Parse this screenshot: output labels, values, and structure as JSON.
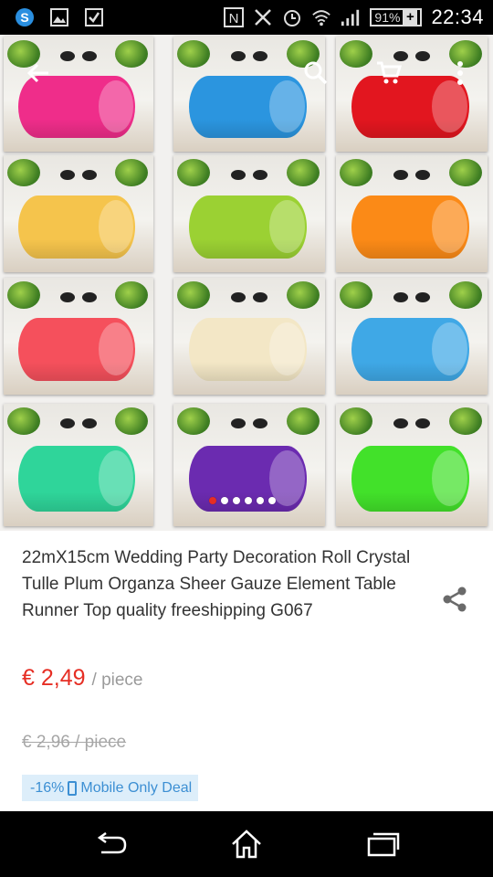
{
  "status_bar": {
    "time": "22:34",
    "battery_percent": "91%",
    "battery_plus": "+",
    "icons": [
      "skype-icon",
      "image-icon",
      "checkbox-icon",
      "nfc-icon",
      "vibrate-off-icon",
      "alarm-icon",
      "wifi-icon",
      "signal-icon"
    ]
  },
  "toolbar": {
    "icons": [
      "back-arrow-icon",
      "search-icon",
      "cart-icon",
      "more-vert-icon"
    ]
  },
  "gallery": {
    "image_count": 6,
    "active_index": 0,
    "swatches": [
      {
        "name": "fuchsia",
        "color": "#ef2d8a"
      },
      {
        "name": "blue",
        "color": "#2b95df"
      },
      {
        "name": "red",
        "color": "#e2161f"
      },
      {
        "name": "yellow",
        "color": "#f5c44c"
      },
      {
        "name": "lime",
        "color": "#9bd133"
      },
      {
        "name": "orange",
        "color": "#fb8a17"
      },
      {
        "name": "coral",
        "color": "#f5505c"
      },
      {
        "name": "ivory",
        "color": "#f3e7c6"
      },
      {
        "name": "sky",
        "color": "#3fa8e6"
      },
      {
        "name": "mint",
        "color": "#2fd59a"
      },
      {
        "name": "purple",
        "color": "#6b2bb0"
      },
      {
        "name": "green",
        "color": "#42e12a"
      }
    ]
  },
  "product": {
    "title": "22mX15cm Wedding Party Decoration Roll Crystal Tulle Plum Organza Sheer Gauze Element Table Runner Top quality freeshipping G067",
    "price": "€ 2,49",
    "unit": "/ piece",
    "old_price": "€ 2,96 / piece",
    "deal_discount": "-16%",
    "deal_label": "Mobile Only Deal"
  },
  "colors": {
    "accent_red": "#e62e24",
    "deal_blue": "#3c8fd3",
    "deal_bg": "#ddeefa"
  },
  "nav_bar": {
    "icons": [
      "back-icon",
      "home-icon",
      "recent-apps-icon"
    ]
  }
}
